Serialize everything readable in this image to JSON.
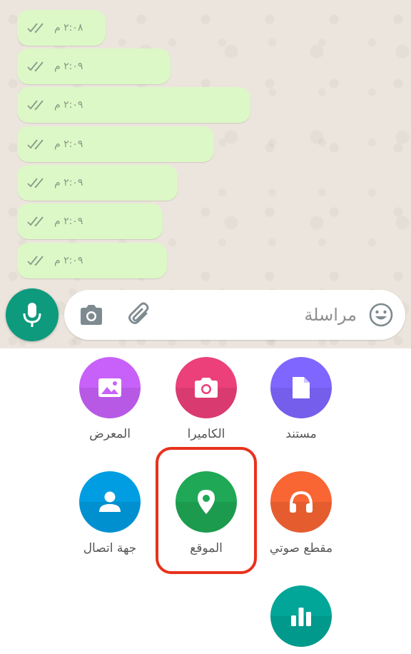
{
  "chat": {
    "messages": [
      {
        "time": "٢:٠٨ م",
        "status": "read"
      },
      {
        "time": "٢:٠٩ م",
        "status": "read"
      },
      {
        "time": "٢:٠٩ م",
        "status": "read"
      },
      {
        "time": "٢:٠٩ م",
        "status": "read"
      },
      {
        "time": "٢:٠٩ م",
        "status": "read"
      },
      {
        "time": "٢:٠٩ م",
        "status": "read"
      },
      {
        "time": "٢:٠٩ م",
        "status": "read"
      }
    ],
    "bubble_color": "#dcf8c6",
    "background_color": "#ece5dd"
  },
  "input_bar": {
    "placeholder": "مراسلة",
    "icons": [
      "camera-icon",
      "paperclip-icon",
      "emoji-icon"
    ],
    "mic_icon": "microphone-icon",
    "mic_color": "#0d9a7d"
  },
  "attachments": {
    "items": [
      {
        "label": "مستند",
        "icon": "document-icon",
        "color": "#7f66ff"
      },
      {
        "label": "الكاميرا",
        "icon": "camera-icon",
        "color": "#ec407a"
      },
      {
        "label": "المعرض",
        "icon": "gallery-icon",
        "color": "#c861fa"
      },
      {
        "label": "مقطع صوتي",
        "icon": "headphones-icon",
        "color": "#f96533"
      },
      {
        "label": "الموقع",
        "icon": "location-pin-icon",
        "color": "#1fa855"
      },
      {
        "label": "جهة اتصال",
        "icon": "contact-icon",
        "color": "#009de2"
      },
      {
        "label": "",
        "icon": "poll-icon",
        "color": "#02a698"
      }
    ],
    "highlighted": "الموقع",
    "highlight_color": "#e8321c"
  }
}
